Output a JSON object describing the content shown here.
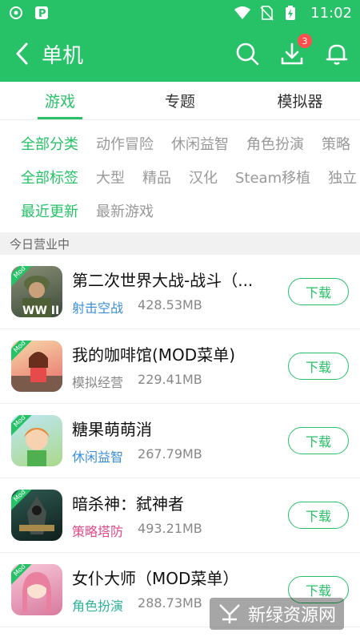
{
  "status": {
    "time": "11:02"
  },
  "header": {
    "title": "单机",
    "download_badge": "3"
  },
  "tabs": [
    {
      "label": "游戏",
      "active": true
    },
    {
      "label": "专题",
      "active": false
    },
    {
      "label": "模拟器",
      "active": false
    }
  ],
  "filters": {
    "row1": [
      "全部分类",
      "动作冒险",
      "休闲益智",
      "角色扮演",
      "策略"
    ],
    "row2": [
      "全部标签",
      "大型",
      "精品",
      "汉化",
      "Steam移植",
      "独立"
    ],
    "row3": [
      "最近更新",
      "最新游戏"
    ]
  },
  "section": {
    "title": "今日营业中"
  },
  "games": [
    {
      "name": "第二次世界大战-战斗（...",
      "category": "射击空战",
      "size": "428.53MB",
      "category_color": "#3b8fd9",
      "download": "下载",
      "icon": "ww2-soldier-icon"
    },
    {
      "name": "我的咖啡馆(MOD菜单)",
      "category": "模拟经营",
      "size": "229.41MB",
      "category_color": "#888888",
      "download": "下载",
      "icon": "cafe-girl-icon"
    },
    {
      "name": "糖果萌萌消",
      "category": "休闲益智",
      "size": "267.79MB",
      "category_color": "#3b8fd9",
      "download": "下载",
      "icon": "candy-girl-icon"
    },
    {
      "name": "暗杀神：弑神者",
      "category": "策略塔防",
      "size": "493.21MB",
      "category_color": "#e04a8a",
      "download": "下载",
      "icon": "assassin-icon"
    },
    {
      "name": "女仆大师（MOD菜单）",
      "category": "角色扮演",
      "size": "288.73MB",
      "category_color": "#2bb39a",
      "download": "下载",
      "icon": "maid-icon"
    }
  ],
  "watermark": {
    "text": "新绿资源网",
    "url": "www.xlhs.com"
  },
  "colors": {
    "brand": "#27c267"
  }
}
